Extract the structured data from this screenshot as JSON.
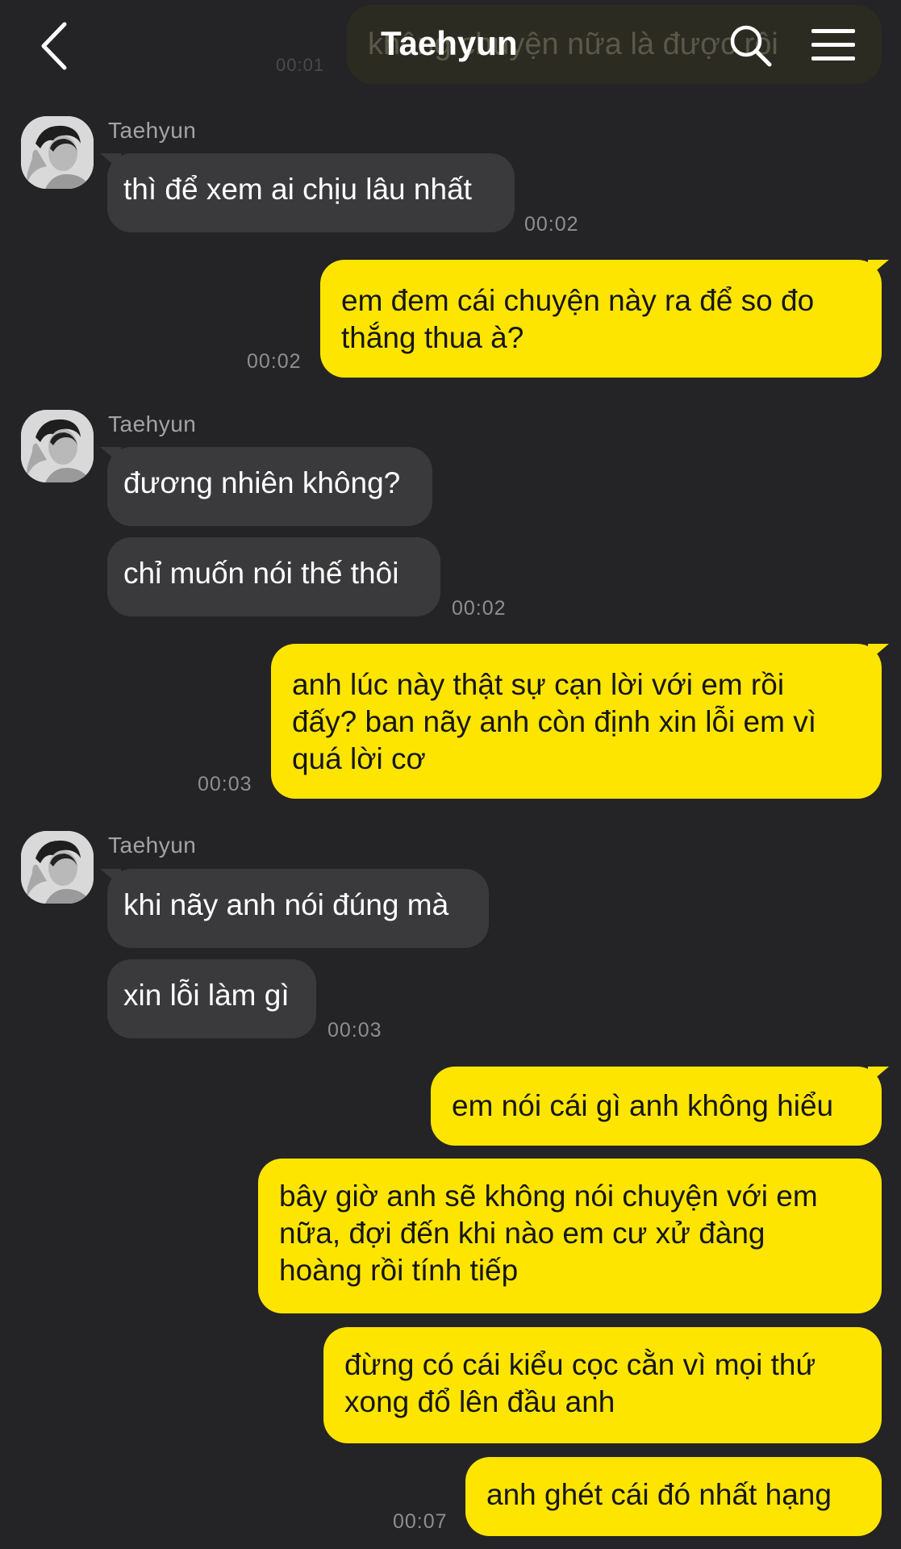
{
  "header": {
    "title": "Taehyun",
    "notice_text": "không chuyện nữa là được rồi",
    "notice_time": "00:01"
  },
  "messages": [
    {
      "from": "Taehyun",
      "sender_label": "Taehyun",
      "text": "thì để xem ai chịu lâu nhất",
      "time": "00:02"
    },
    {
      "from": "me",
      "lines": [
        "em đem cái chuyện này ra để so đo",
        "thắng thua à?"
      ],
      "time": "00:02"
    },
    {
      "from": "Taehyun",
      "sender_label": "Taehyun",
      "text": "đương nhiên không?"
    },
    {
      "from": "Taehyun",
      "text": "chỉ muốn nói thế thôi",
      "time": "00:02"
    },
    {
      "from": "me",
      "lines": [
        "anh lúc này thật sự cạn lời với em rồi",
        "đấy? ban nãy anh còn định xin lỗi em vì",
        "quá lời cơ"
      ],
      "time": "00:03"
    },
    {
      "from": "Taehyun",
      "sender_label": "Taehyun",
      "text": "khi nãy anh nói đúng mà"
    },
    {
      "from": "Taehyun",
      "text": "xin lỗi làm gì",
      "time": "00:03"
    },
    {
      "from": "me",
      "lines": [
        "em nói cái gì anh không hiểu"
      ]
    },
    {
      "from": "me",
      "lines": [
        "bây giờ anh sẽ không nói chuyện với em",
        "nữa, đợi đến khi nào em cư xử đàng",
        "hoàng rồi tính tiếp"
      ]
    },
    {
      "from": "me",
      "lines": [
        "đừng có cái kiểu cọc cằn vì mọi thứ",
        "xong đổ lên đầu anh"
      ]
    },
    {
      "from": "me",
      "lines": [
        "anh ghét cái đó nhất hạng"
      ],
      "time": "00:07"
    }
  ],
  "colors": {
    "background": "#242426",
    "incoming_bubble": "#3a3a3c",
    "outgoing_bubble": "#fee500",
    "timestamp": "#8e8e8e"
  },
  "icons": [
    "back-chevron-icon",
    "search-icon",
    "menu-icon",
    "avatar-photo"
  ]
}
